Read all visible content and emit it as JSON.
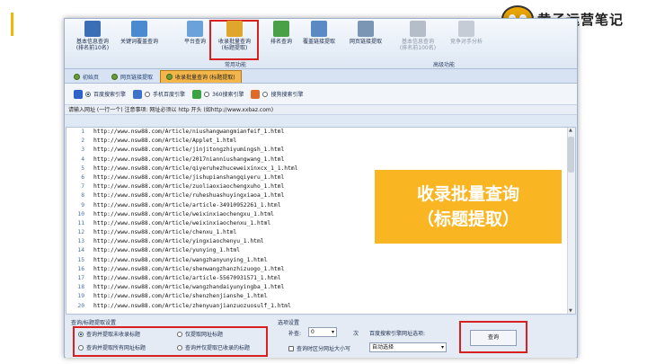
{
  "brand": {
    "logo_text": "黄子运营笔记"
  },
  "toolbar": {
    "items": [
      {
        "label": "基本信息查询\n(排名前10名)",
        "color": "#3a6fb5",
        "enabled": true
      },
      {
        "label": "关键词覆盖查询",
        "color": "#4b8ad1",
        "enabled": true
      },
      {
        "label": "平台查询",
        "color": "#6aa2d9",
        "enabled": true
      },
      {
        "label": "收录批量查询\n(标题提取)",
        "color": "#e0a62c",
        "enabled": true
      },
      {
        "label": "排名查询",
        "color": "#4aa046",
        "enabled": true
      },
      {
        "label": "覆盖链接提取",
        "color": "#5a89c4",
        "enabled": true
      },
      {
        "label": "网页链接提取",
        "color": "#7b95b5",
        "enabled": true
      },
      {
        "label": "基本信息查询\n(排名前100名)",
        "color": "#b5bdc9",
        "enabled": false
      },
      {
        "label": "竞争对手分析",
        "color": "#c5ccd6",
        "enabled": false
      }
    ],
    "group_common": "常用功能",
    "group_advanced": "高级功能"
  },
  "tabs": [
    {
      "label": "初始页",
      "active": false
    },
    {
      "label": "网页链接提取",
      "active": false
    },
    {
      "label": "收录批量查询 (标题提取)",
      "active": true
    }
  ],
  "engines": [
    {
      "label": "百度搜索引擎",
      "checked": true,
      "color": "#2f62c9"
    },
    {
      "label": "手机百度引擎",
      "checked": false,
      "color": "#3f73c9"
    },
    {
      "label": "360搜索引擎",
      "checked": false,
      "color": "#3aa243"
    },
    {
      "label": "搜狗搜索引擎",
      "checked": false,
      "color": "#e06a2a"
    }
  ],
  "hint": "请输入网址 (一行一个) 注意事项: 网址必须以 http 开头 (如http://www.xxbaz.com)",
  "urls": [
    "http://www.nsw88.com/Article/niushangwangmianfeif_1.html",
    "http://www.nsw88.com/Article/Applet_1.html",
    "http://www.nsw88.com/Article/jinjitongzhiyumingsh_1.html",
    "http://www.nsw88.com/Article/2017nianniushangwang_1.html",
    "http://www.nsw88.com/Article/qiyeruhezhuceweixinxcx_1_1.html",
    "http://www.nsw88.com/Article/jishupianshangqiyeru_1.html",
    "http://www.nsw88.com/Article/zuoliaoxiaochengxuho_1.html",
    "http://www.nsw88.com/Article/ruheshuashuyingxiaoa_1.html",
    "http://www.nsw88.com/Article/article-34910952261_1.html",
    "http://www.nsw88.com/Article/weixinxiaochengxu_1.html",
    "http://www.nsw88.com/Article/weixinxiaochenxu_1.html",
    "http://www.nsw88.com/Article/chenxu_1.html",
    "http://www.nsw88.com/Article/yingxiaochenyu_1.html",
    "http://www.nsw88.com/Article/yunying_1.html",
    "http://www.nsw88.com/Article/wangzhanyunying_1.html",
    "http://www.nsw88.com/Article/shenwangzhanzhizuogo_1.html",
    "http://www.nsw88.com/Article/article-55670931571_1.html",
    "http://www.nsw88.com/Article/wangzhandaiyunyingba_1.html",
    "http://www.nsw88.com/Article/shenzhenjianshe_1.html",
    "http://www.nsw88.com/Article/zhenyuanjianzuozuosulf_1.html"
  ],
  "overlay": {
    "line1": "收录批量查询",
    "line2": "（标题提取）"
  },
  "settings": {
    "group_title": "查询/标题提取设置",
    "options": [
      {
        "label": "查询并提取未收录标题",
        "checked": true
      },
      {
        "label": "仅提取网址标题",
        "checked": false
      },
      {
        "label": "查询并提取所有网址标题",
        "checked": false
      },
      {
        "label": "查询并仅提取已收录的标题",
        "checked": false
      }
    ],
    "select_title": "选项设置",
    "interval_label": "补查:",
    "interval_value": "0",
    "interval_unit": "次",
    "engine_option_label": "百度搜索引擎网址选项:",
    "case_label": "查询时区分网址大小写",
    "engine_option_value": "自动选择",
    "query_button": "查询"
  }
}
